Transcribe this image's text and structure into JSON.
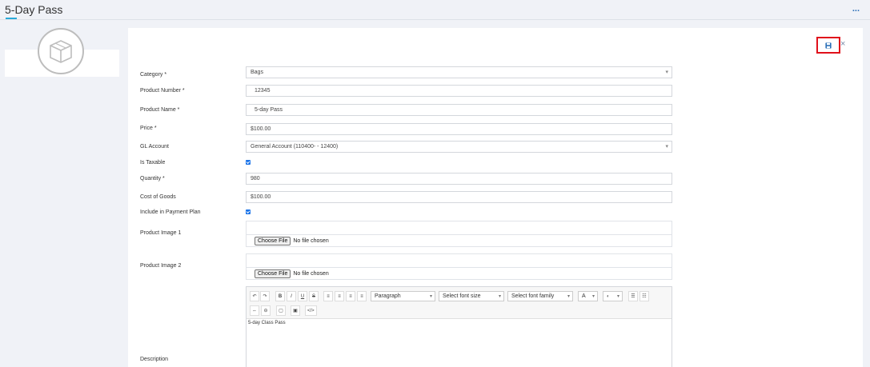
{
  "page": {
    "title": "5-Day Pass",
    "more_label": "..."
  },
  "actions": {
    "save_icon": "floppy-disk-icon",
    "close_label": "×"
  },
  "form": {
    "category": {
      "label": "Category *",
      "value": "Bags"
    },
    "product_number": {
      "label": "Product Number *",
      "value": "12345"
    },
    "product_name": {
      "label": "Product Name *",
      "value": "5-day Pass"
    },
    "price": {
      "label": "Price *",
      "value": "$100.00"
    },
    "gl_account": {
      "label": "GL Account",
      "value": "General Account (110400- - 12400)"
    },
    "is_taxable": {
      "label": "Is Taxable",
      "checked": true
    },
    "quantity": {
      "label": "Quantity *",
      "value": "980"
    },
    "cost_of_goods": {
      "label": "Cost of Goods",
      "value": "$100.00"
    },
    "payment_plan": {
      "label": "Include in Payment Plan",
      "checked": true
    },
    "image1": {
      "label": "Product Image 1",
      "button": "Choose File",
      "status": "No file chosen"
    },
    "image2": {
      "label": "Product Image 2",
      "button": "Choose File",
      "status": "No file chosen"
    },
    "description": {
      "label": "Description",
      "content": "5-day Class Pass"
    }
  },
  "editor": {
    "buttons": [
      "↶",
      "↷",
      "B",
      "I",
      "U",
      "S",
      "≡",
      "≡",
      "≡",
      "≡"
    ],
    "paragraph": "Paragraph",
    "font_size": "Select font size",
    "font_family": "Select font family",
    "font_color": "A",
    "row2": [
      "⇔",
      "⊖",
      "▢",
      "▣",
      "</>"
    ]
  },
  "colors": {
    "accent": "#29a9d8",
    "highlight": "#e0101b",
    "checkbox": "#1a73e8"
  }
}
